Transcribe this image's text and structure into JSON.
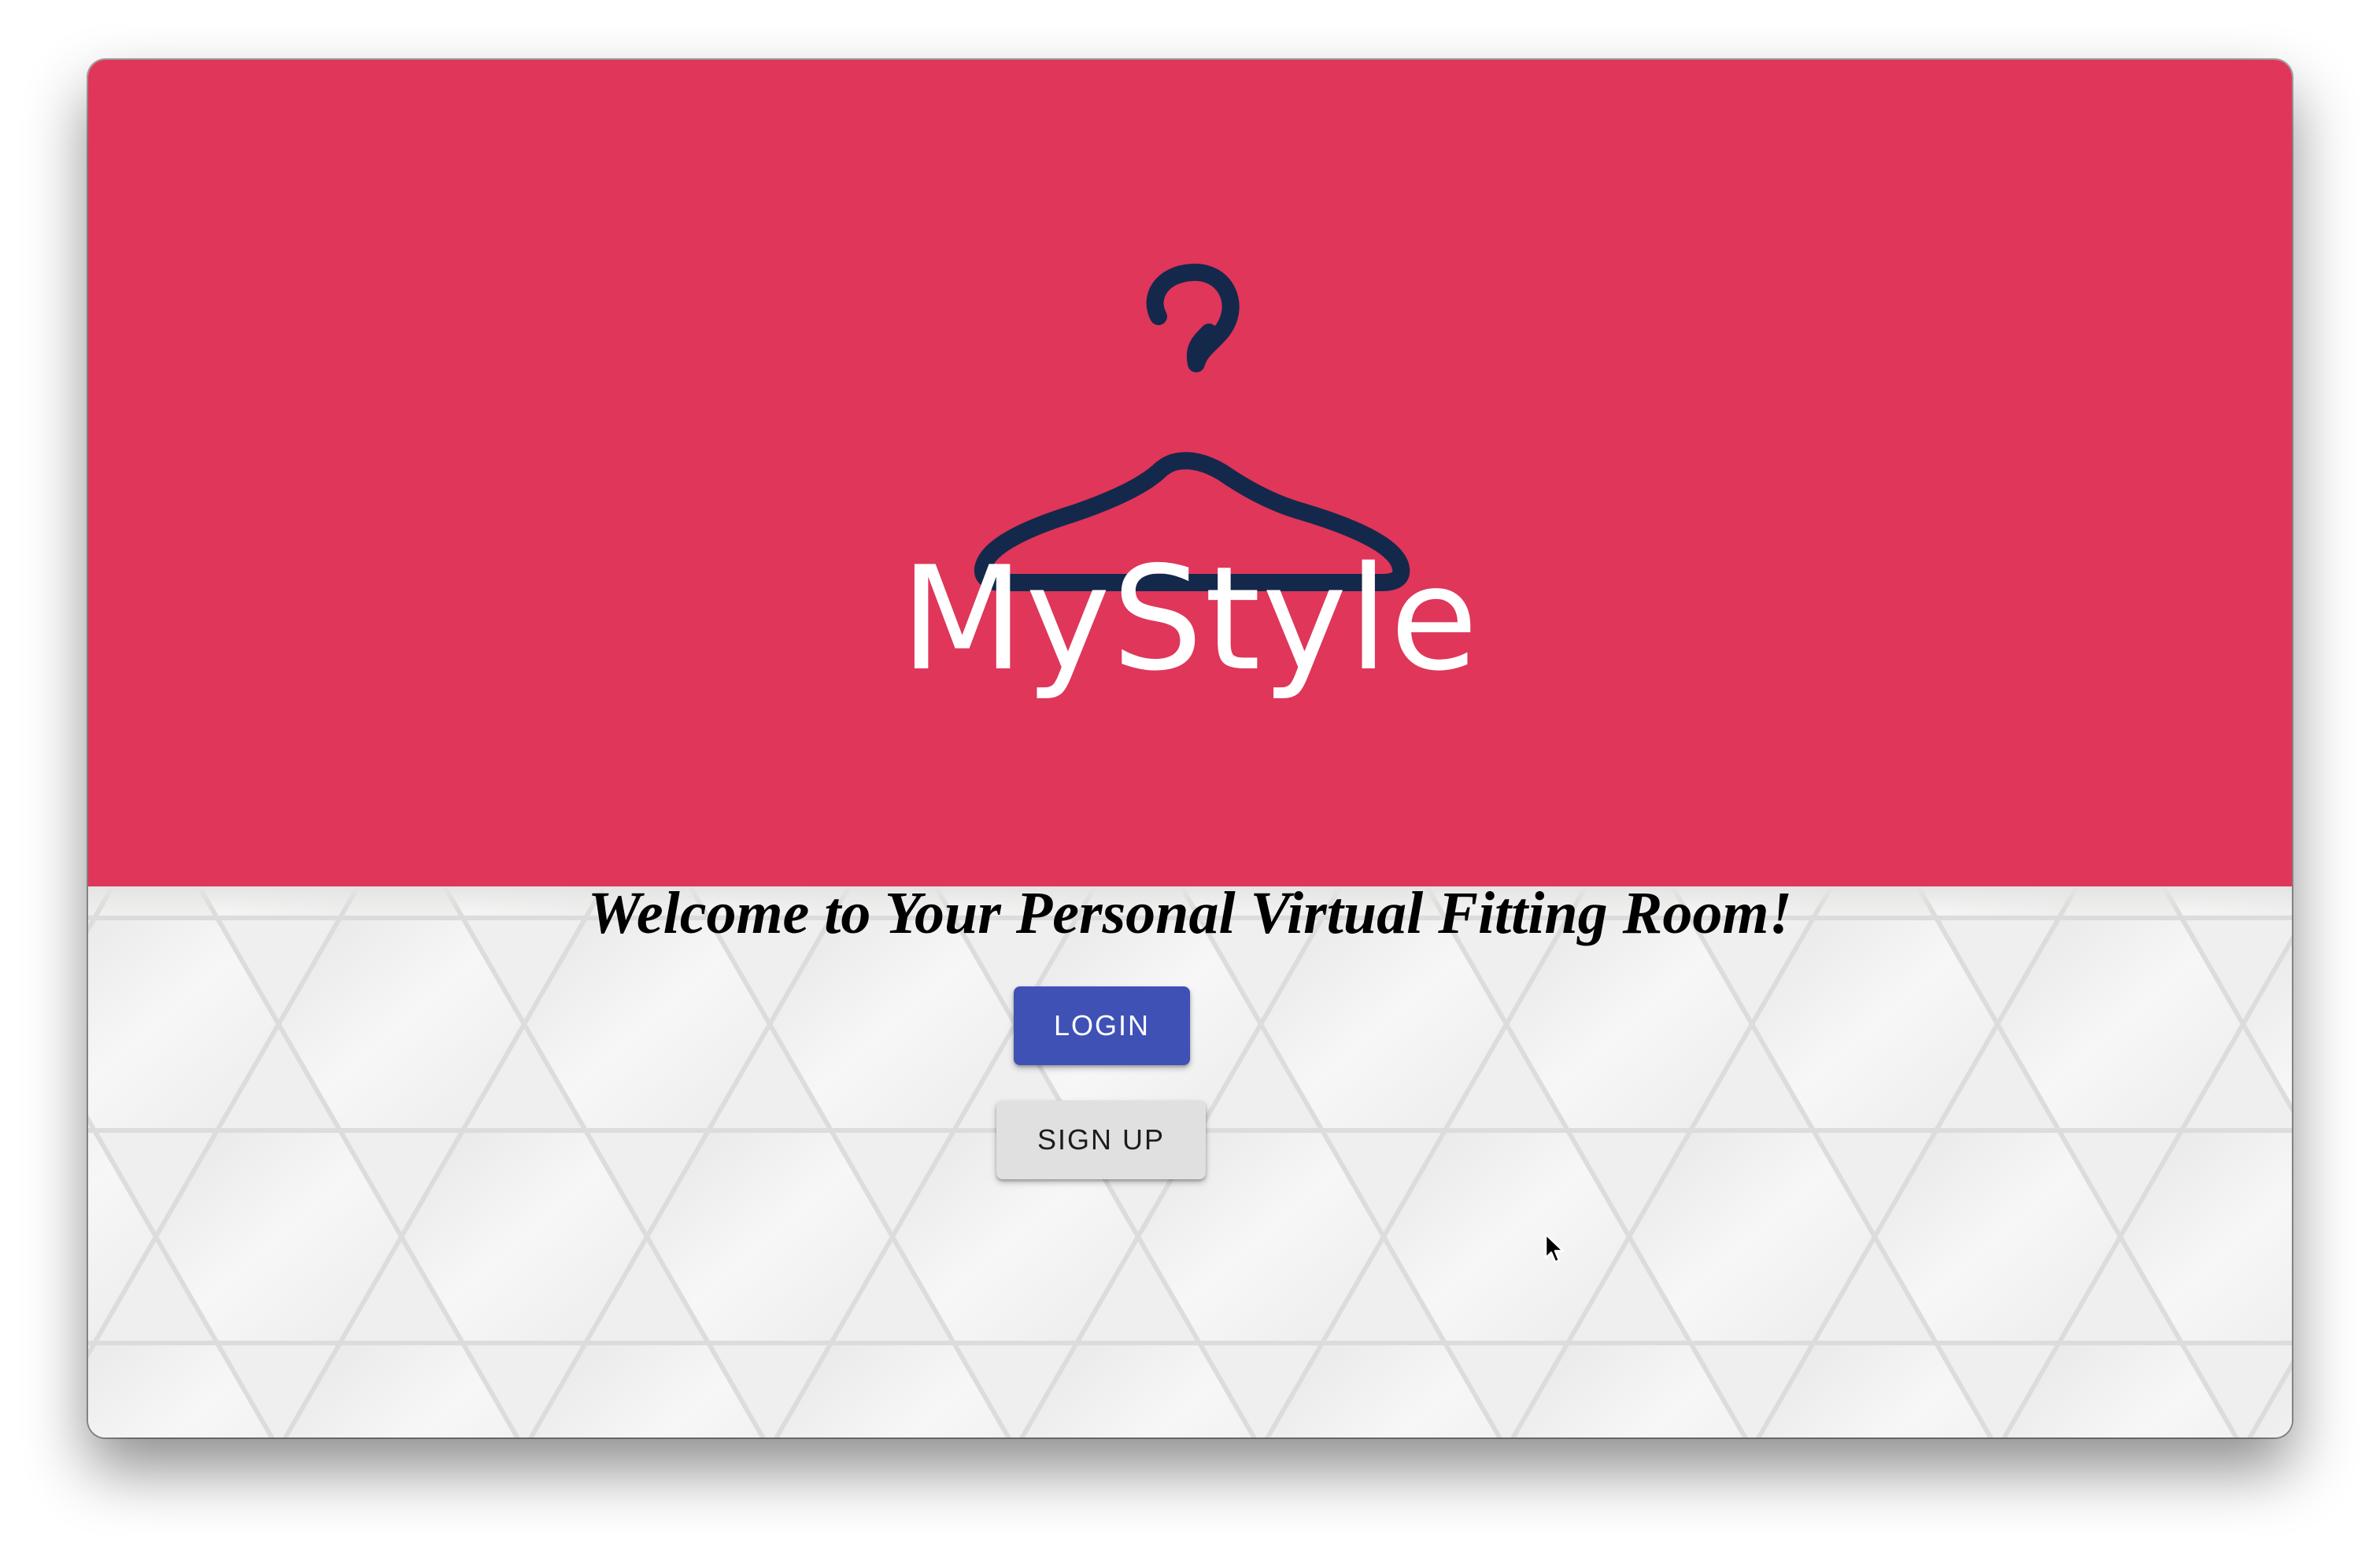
{
  "app": {
    "brand_name": "MyStyle",
    "logo_icon": "hanger-icon"
  },
  "main": {
    "welcome_text": "Welcome to Your Personal Virtual Fitting Room!",
    "login_label": "LOGIN",
    "signup_label": "SIGN UP"
  },
  "colors": {
    "hero_background": "#df365a",
    "hanger": "#14284b",
    "login_button": "#3f51b5",
    "signup_button": "#e0e0e0",
    "pattern_background": "#efefef"
  }
}
